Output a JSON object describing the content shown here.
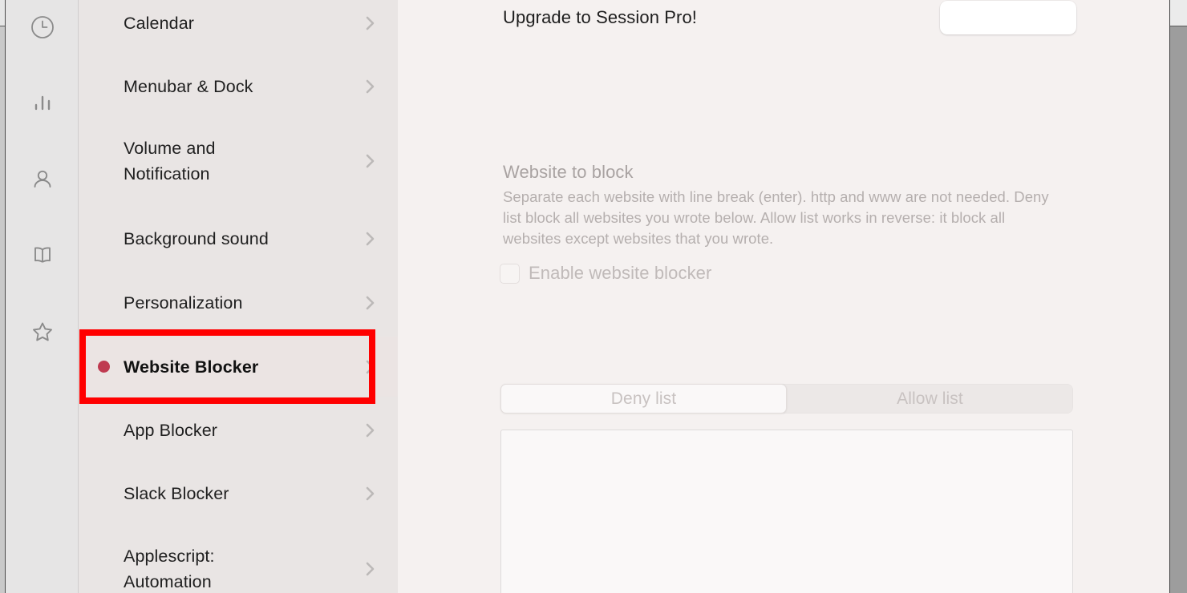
{
  "rail": {
    "icons": [
      {
        "name": "clock-icon",
        "label": "Timer"
      },
      {
        "name": "bar-chart-icon",
        "label": "Statistics"
      },
      {
        "name": "person-icon",
        "label": "Account"
      },
      {
        "name": "book-icon",
        "label": "Guide"
      },
      {
        "name": "star-icon",
        "label": "Favorites"
      }
    ]
  },
  "sidebar": {
    "items": [
      {
        "label": "Calendar",
        "selected": false
      },
      {
        "label": "Menubar & Dock",
        "selected": false
      },
      {
        "label": "Volume and\nNotification",
        "selected": false
      },
      {
        "label": "Background sound",
        "selected": false
      },
      {
        "label": "Personalization",
        "selected": false
      },
      {
        "label": "Website Blocker",
        "selected": true
      },
      {
        "label": "App Blocker",
        "selected": false
      },
      {
        "label": "Slack Blocker",
        "selected": false
      },
      {
        "label": "Applescript:\nAutomation",
        "selected": false
      }
    ],
    "selected_dot_color": "#bf3a50"
  },
  "annotation": {
    "color": "#ff0000",
    "target": "Website Blocker"
  },
  "main": {
    "upgrade": {
      "text": "Upgrade to Session Pro!",
      "button_label": ""
    },
    "website_to_block": {
      "title": "Website to block",
      "description": "Separate each website with line break (enter). http and www are not needed. Deny list block all websites you wrote below. Allow list works in reverse: it block all websites except websites that you wrote.",
      "enable_checkbox": {
        "label": "Enable website blocker",
        "checked": false
      },
      "segments": [
        {
          "label": "Deny list",
          "active": true
        },
        {
          "label": "Allow list",
          "active": false
        }
      ],
      "list_value": ""
    }
  }
}
